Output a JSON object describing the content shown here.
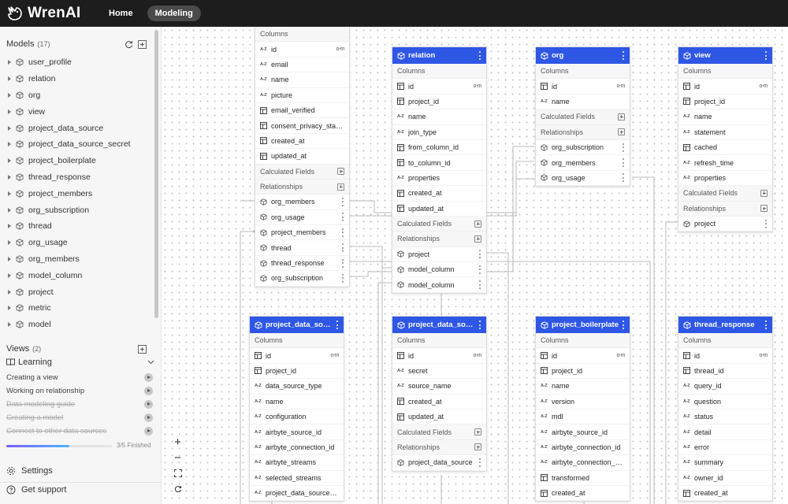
{
  "app": {
    "name": "WrenAI",
    "nav": [
      {
        "label": "Home",
        "active": false
      },
      {
        "label": "Modeling",
        "active": true
      }
    ]
  },
  "sidebar": {
    "models_label": "Models",
    "models_count": "(17)",
    "models": [
      "user_profile",
      "relation",
      "org",
      "view",
      "project_data_source",
      "project_data_source_secret",
      "project_boilerplate",
      "thread_response",
      "project_members",
      "org_subscription",
      "thread",
      "org_usage",
      "org_members",
      "model_column",
      "project",
      "metric",
      "model"
    ],
    "views_label": "Views",
    "views_count": "(2)",
    "learning": {
      "title": "Learning",
      "items": [
        {
          "label": "Creating a view",
          "done": false
        },
        {
          "label": "Working on relationship",
          "done": false
        },
        {
          "label": "Data modeling guide",
          "done": true
        },
        {
          "label": "Creating a model",
          "done": true
        },
        {
          "label": "Connect to other data sources",
          "done": true
        }
      ],
      "progress_text": "3/5 Finished",
      "progress_fraction": 0.6
    },
    "settings_label": "Settings",
    "support_label": "Get support"
  },
  "nodes": {
    "user_profile": {
      "columns_label": "Columns",
      "columns": [
        {
          "name": "id",
          "type": "text",
          "key": "🔑"
        },
        {
          "name": "email",
          "type": "text"
        },
        {
          "name": "name",
          "type": "text"
        },
        {
          "name": "picture",
          "type": "text"
        },
        {
          "name": "email_verified",
          "type": "table"
        },
        {
          "name": "consent_privacy_statement",
          "type": "table"
        },
        {
          "name": "created_at",
          "type": "table"
        },
        {
          "name": "updated_at",
          "type": "table"
        }
      ],
      "calc_label": "Calculated Fields",
      "rel_label": "Relationships",
      "relationships": [
        "org_members",
        "org_usage",
        "project_members",
        "thread",
        "thread_response",
        "org_subscription"
      ]
    },
    "relation": {
      "title": "relation",
      "columns_label": "Columns",
      "columns": [
        {
          "name": "id",
          "type": "table",
          "key": "🔑"
        },
        {
          "name": "project_id",
          "type": "table"
        },
        {
          "name": "name",
          "type": "text"
        },
        {
          "name": "join_type",
          "type": "text"
        },
        {
          "name": "from_column_id",
          "type": "table"
        },
        {
          "name": "to_column_id",
          "type": "table"
        },
        {
          "name": "properties",
          "type": "text"
        },
        {
          "name": "created_at",
          "type": "table"
        },
        {
          "name": "updated_at",
          "type": "table"
        }
      ],
      "calc_label": "Calculated Fields",
      "rel_label": "Relationships",
      "relationships": [
        "project",
        "model_column",
        "model_column"
      ]
    },
    "org": {
      "title": "org",
      "columns_label": "Columns",
      "columns": [
        {
          "name": "id",
          "type": "table",
          "key": "🔑"
        },
        {
          "name": "name",
          "type": "text"
        }
      ],
      "calc_label": "Calculated Fields",
      "rel_label": "Relationships",
      "relationships": [
        "org_subscription",
        "org_members",
        "org_usage"
      ]
    },
    "view": {
      "title": "view",
      "columns_label": "Columns",
      "columns": [
        {
          "name": "id",
          "type": "table",
          "key": "🔑"
        },
        {
          "name": "project_id",
          "type": "table"
        },
        {
          "name": "name",
          "type": "text"
        },
        {
          "name": "statement",
          "type": "text"
        },
        {
          "name": "cached",
          "type": "table"
        },
        {
          "name": "refresh_time",
          "type": "text"
        },
        {
          "name": "properties",
          "type": "text"
        }
      ],
      "calc_label": "Calculated Fields",
      "rel_label": "Relationships",
      "relationships": [
        "project"
      ]
    },
    "project_data_source": {
      "title": "project_data_source",
      "columns_label": "Columns",
      "columns": [
        {
          "name": "id",
          "type": "table",
          "key": "🔑"
        },
        {
          "name": "project_id",
          "type": "table"
        },
        {
          "name": "data_source_type",
          "type": "text"
        },
        {
          "name": "name",
          "type": "text"
        },
        {
          "name": "configuration",
          "type": "text"
        },
        {
          "name": "airbyte_source_id",
          "type": "text"
        },
        {
          "name": "airbyte_connection_id",
          "type": "text"
        },
        {
          "name": "airbyte_streams",
          "type": "text"
        },
        {
          "name": "selected_streams",
          "type": "text"
        },
        {
          "name": "project_data_source_secret_id",
          "type": "text"
        }
      ]
    },
    "project_data_source_secret": {
      "title": "project_data_source_secret",
      "columns_label": "Columns",
      "columns": [
        {
          "name": "id",
          "type": "table",
          "key": "🔑"
        },
        {
          "name": "secret",
          "type": "text"
        },
        {
          "name": "source_name",
          "type": "text"
        },
        {
          "name": "created_at",
          "type": "table"
        },
        {
          "name": "updated_at",
          "type": "table"
        }
      ],
      "calc_label": "Calculated Fields",
      "rel_label": "Relationships",
      "relationships": [
        "project_data_source"
      ]
    },
    "project_boilerplate": {
      "title": "project_boilerplate",
      "columns_label": "Columns",
      "columns": [
        {
          "name": "id",
          "type": "table",
          "key": "🔑"
        },
        {
          "name": "project_id",
          "type": "table"
        },
        {
          "name": "name",
          "type": "text"
        },
        {
          "name": "version",
          "type": "text"
        },
        {
          "name": "mdl",
          "type": "text"
        },
        {
          "name": "airbyte_source_id",
          "type": "text"
        },
        {
          "name": "airbyte_connection_id",
          "type": "text"
        },
        {
          "name": "airbyte_connection_cron",
          "type": "text"
        },
        {
          "name": "transformed",
          "type": "table"
        },
        {
          "name": "created_at",
          "type": "table"
        }
      ]
    },
    "thread_response": {
      "title": "thread_response",
      "columns_label": "Columns",
      "columns": [
        {
          "name": "id",
          "type": "table",
          "key": "🔑"
        },
        {
          "name": "thread_id",
          "type": "table"
        },
        {
          "name": "query_id",
          "type": "text"
        },
        {
          "name": "question",
          "type": "text"
        },
        {
          "name": "status",
          "type": "text"
        },
        {
          "name": "detail",
          "type": "text"
        },
        {
          "name": "error",
          "type": "text"
        },
        {
          "name": "summary",
          "type": "text"
        },
        {
          "name": "owner_id",
          "type": "text"
        },
        {
          "name": "created_at",
          "type": "table"
        }
      ]
    }
  },
  "colors": {
    "node_header": "#2f57e6",
    "topbar": "#1d1d1d",
    "sidebar": "#f6f6f6"
  }
}
